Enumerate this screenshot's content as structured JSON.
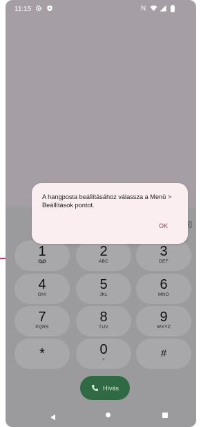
{
  "status_bar": {
    "time": "11:15",
    "nfc_label": "N",
    "icons": [
      "gear-icon",
      "shield-icon",
      "nfc-icon",
      "wifi-icon",
      "signal-icon",
      "battery-icon"
    ]
  },
  "dialog": {
    "message": "A hangposta beállításához válassza a Menü > Beállítások pontot.",
    "ok_label": "OK"
  },
  "dialpad": {
    "keys": [
      {
        "digit": "1",
        "letters": ""
      },
      {
        "digit": "2",
        "letters": "ABC"
      },
      {
        "digit": "3",
        "letters": "DEF"
      },
      {
        "digit": "4",
        "letters": "GHI"
      },
      {
        "digit": "5",
        "letters": "JKL"
      },
      {
        "digit": "6",
        "letters": "MNO"
      },
      {
        "digit": "7",
        "letters": "PQRS"
      },
      {
        "digit": "8",
        "letters": "TUV"
      },
      {
        "digit": "9",
        "letters": "WXYZ"
      },
      {
        "digit": "*",
        "letters": ""
      },
      {
        "digit": "0",
        "letters": "+"
      },
      {
        "digit": "#",
        "letters": ""
      }
    ]
  },
  "call_button": {
    "label": "Hívás"
  },
  "colors": {
    "screen_dim": "#a59ea4",
    "dialog_bg": "#fbeef0",
    "call_button": "#2f6a44",
    "annotation_line": "#d02b86"
  }
}
